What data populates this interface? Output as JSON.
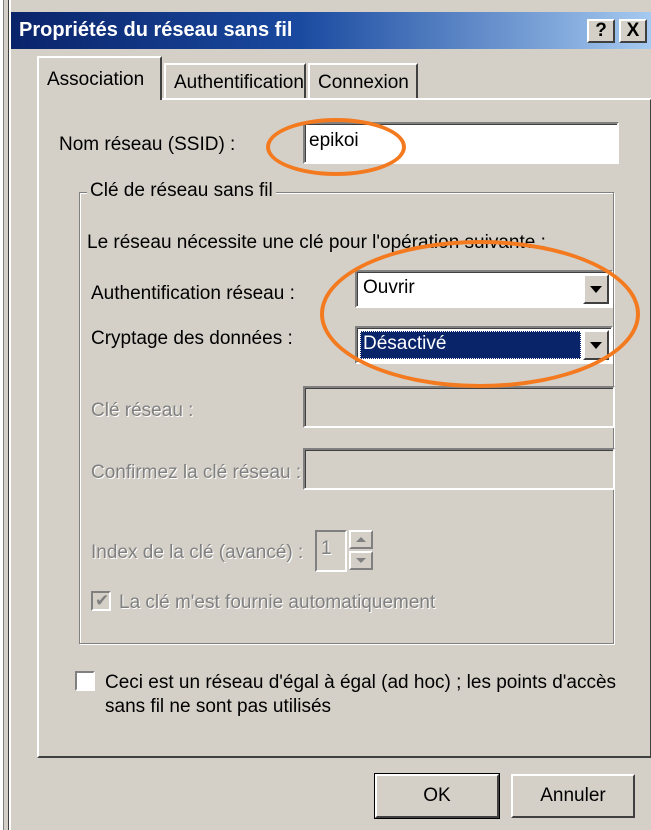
{
  "window": {
    "title": "Propriétés du réseau sans fil",
    "help_label": "?",
    "close_label": "X"
  },
  "tabs": [
    {
      "label": "Association",
      "active": true
    },
    {
      "label": "Authentification",
      "active": false
    },
    {
      "label": "Connexion",
      "active": false
    }
  ],
  "ssid": {
    "label": "Nom réseau (SSID) :",
    "value": "epikoi"
  },
  "wireless_key": {
    "group_label": "Clé de réseau sans fil",
    "intro": "Le réseau nécessite une clé pour l'opération suivante :",
    "auth_label": "Authentification réseau :",
    "auth_value": "Ouvrir",
    "encryption_label": "Cryptage des données :",
    "encryption_value": "Désactivé",
    "network_key_label": "Clé réseau :",
    "confirm_key_label": "Confirmez la clé réseau :",
    "key_index_label": "Index de la clé (avancé) :",
    "key_index_value": "1",
    "auto_key_label": "La clé m'est fournie automatiquement",
    "auto_key_checked": true
  },
  "adhoc": {
    "label_line1": "Ceci est un réseau d'égal à égal (ad hoc) ; les points d'accès",
    "label_line2": "sans fil ne sont pas utilisés",
    "checked": false
  },
  "buttons": {
    "ok": "OK",
    "cancel": "Annuler"
  },
  "colors": {
    "titlebar": "#0a246a",
    "face": "#d4d0c8",
    "selection": "#0a246a",
    "annotation": "#f47a20"
  }
}
